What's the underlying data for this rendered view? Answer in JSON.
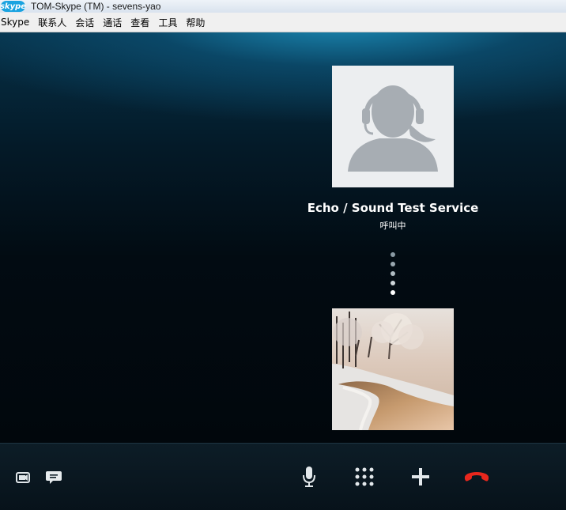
{
  "window": {
    "title": "TOM-Skype (TM) - sevens-yao",
    "logo_text": "skype"
  },
  "menu": {
    "items": [
      {
        "label": "Skype",
        "name": "menu-skype"
      },
      {
        "label": "联系人",
        "name": "menu-contacts"
      },
      {
        "label": "会话",
        "name": "menu-conversations"
      },
      {
        "label": "通话",
        "name": "menu-call"
      },
      {
        "label": "查看",
        "name": "menu-view"
      },
      {
        "label": "工具",
        "name": "menu-tools"
      },
      {
        "label": "帮助",
        "name": "menu-help"
      }
    ]
  },
  "call": {
    "contact_name": "Echo / Sound Test Service",
    "status": "呼叫中",
    "avatar_icon": "headset-person-icon"
  },
  "controls": {
    "left": [
      "video-toggle-icon",
      "chat-bubble-icon"
    ],
    "right": [
      "microphone-icon",
      "dialpad-icon",
      "plus-icon",
      "hang-up-icon"
    ]
  },
  "colors": {
    "hangup": "#e8271d",
    "title_logo": "#1aa3e0",
    "call_bg_top": "#1e96c3"
  }
}
